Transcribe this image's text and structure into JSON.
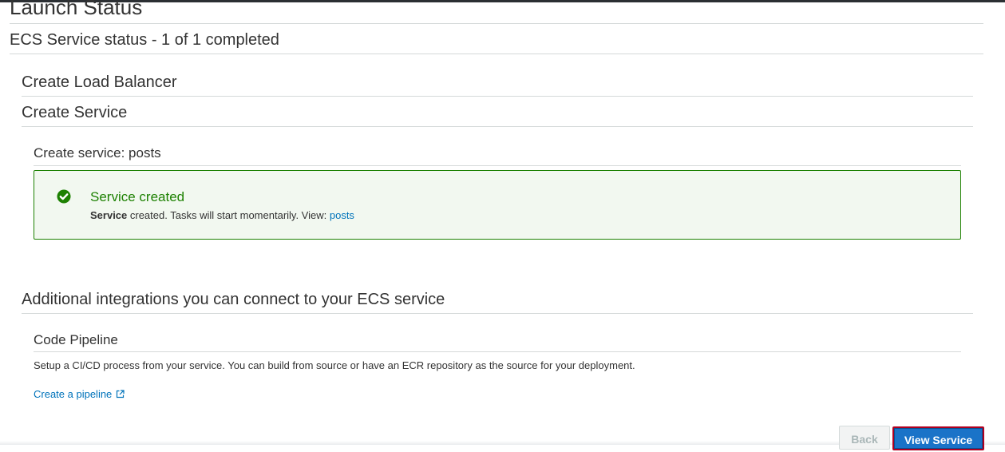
{
  "page": {
    "title": "Launch Status"
  },
  "status": {
    "heading": "ECS Service status - 1 of 1 completed"
  },
  "steps": {
    "load_balancer": "Create Load Balancer",
    "service": "Create Service",
    "service_sub": "Create service: posts"
  },
  "alert": {
    "title": "Service created",
    "message_bold": "Service",
    "message_text": " created. Tasks will start momentarily. View: ",
    "link_text": "posts",
    "status_color": "#1d8102",
    "icon": "check-circle-icon"
  },
  "integrations": {
    "heading": "Additional integrations you can connect to your ECS service",
    "code_pipeline": {
      "title": "Code Pipeline",
      "description": "Setup a CI/CD process from your service. You can build from source or have an ECR repository as the source for your deployment.",
      "link_text": "Create a pipeline",
      "link_icon": "external-link-icon"
    }
  },
  "footer": {
    "back_label": "Back",
    "view_service_label": "View Service"
  },
  "colors": {
    "link": "#0073bb",
    "primary_button": "#1a73c8",
    "success": "#1d8102"
  }
}
